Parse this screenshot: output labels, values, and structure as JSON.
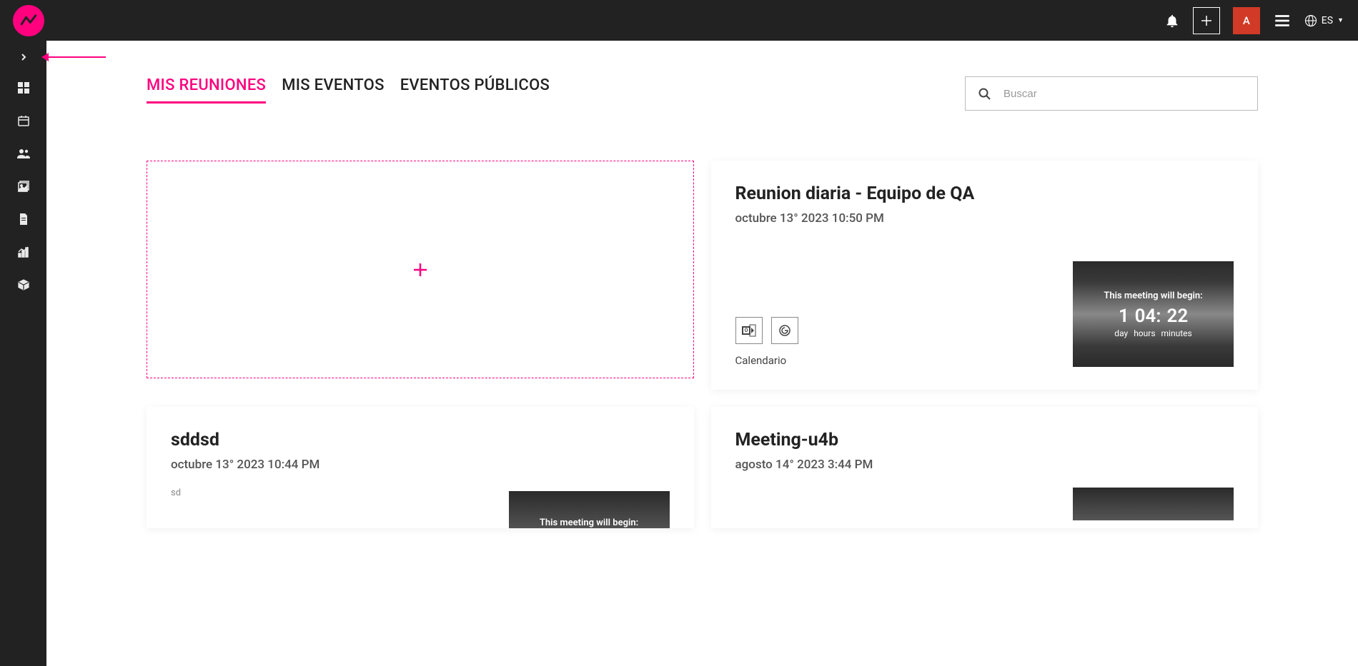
{
  "header": {
    "avatar_letter": "A",
    "language": "ES"
  },
  "sidebar": {},
  "tabs": [
    {
      "label": "MIS REUNIONES",
      "active": true
    },
    {
      "label": "MIS EVENTOS",
      "active": false
    },
    {
      "label": "EVENTOS PÚBLICOS",
      "active": false
    }
  ],
  "search": {
    "placeholder": "Buscar"
  },
  "cards": [
    {
      "type": "add"
    },
    {
      "type": "meeting",
      "title": "Reunion diaria - Equipo de QA",
      "date": "octubre 13° 2023 10:50 PM",
      "calendar_label": "Calendario",
      "countdown": {
        "begin_label": "This meeting will begin:",
        "day": "1",
        "hours": "04:",
        "minutes": "22",
        "day_label": "day",
        "hours_label": "hours",
        "minutes_label": "minutes"
      }
    },
    {
      "type": "meeting",
      "title": "sddsd",
      "date": "octubre 13° 2023 10:44 PM",
      "sub": "sd",
      "countdown": {
        "begin_label": "This meeting will begin:"
      }
    },
    {
      "type": "meeting",
      "title": "Meeting-u4b",
      "date": "agosto 14° 2023 3:44 PM"
    }
  ]
}
